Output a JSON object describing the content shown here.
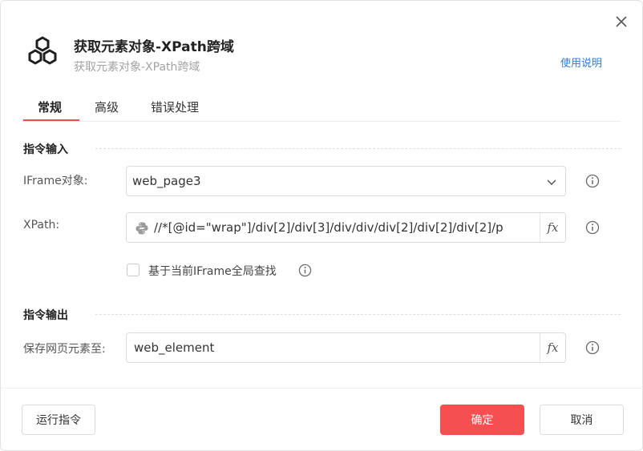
{
  "header": {
    "title": "获取元素对象-XPath跨域",
    "subtitle": "获取元素对象-XPath跨域",
    "help_link": "使用说明",
    "icon": "hexagons-icon"
  },
  "tabs": [
    {
      "label": "常规",
      "active": true
    },
    {
      "label": "高级",
      "active": false
    },
    {
      "label": "错误处理",
      "active": false
    }
  ],
  "input_section": {
    "title": "指令输入",
    "iframe": {
      "label": "IFrame对象:",
      "value": "web_page3"
    },
    "xpath": {
      "label": "XPath:",
      "value": "//*[@id=\"wrap\"]/div[2]/div[3]/div/div/div[2]/div[2]/div[2]/p",
      "fx": "fx"
    },
    "global_search": {
      "label": "基于当前IFrame全局查找",
      "checked": false
    }
  },
  "output_section": {
    "title": "指令输出",
    "save": {
      "label": "保存网页元素至:",
      "value": "web_element",
      "fx": "fx"
    }
  },
  "footer": {
    "run": "运行指令",
    "confirm": "确定",
    "cancel": "取消"
  },
  "colors": {
    "accent": "#f54f4f",
    "link": "#2f7bd9"
  }
}
